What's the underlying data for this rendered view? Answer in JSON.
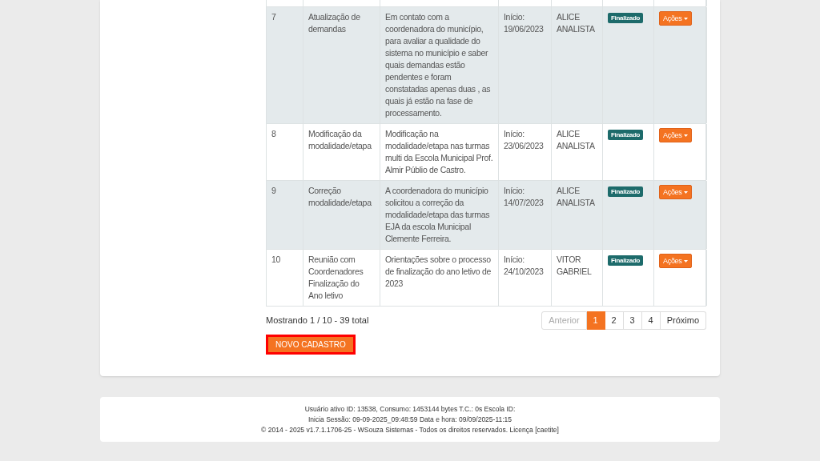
{
  "table": {
    "rows": [
      {
        "number": "7",
        "title": "Atualização de demandas",
        "description": "Em contato com a coordenadora do município, para avaliar a qualidade do sistema no município e saber quais demandas estão pendentes e foram constatadas apenas duas , as quais já estão na fase de processamento.",
        "date_label": "Início:",
        "date": "19/06/2023",
        "responsible": "ALICE ANALISTA",
        "status": "Finalizado",
        "actions": "Ações"
      },
      {
        "number": "8",
        "title": "Modificação da modalidade/etapa",
        "description": "Modificação na modalidade/etapa nas turmas multi da Escola Municipal Prof. Almir Públio de Castro.",
        "date_label": "Início:",
        "date": "23/06/2023",
        "responsible": "ALICE ANALISTA",
        "status": "Finalizado",
        "actions": "Ações"
      },
      {
        "number": "9",
        "title": "Correção modalidade/etapa",
        "description": "A coordenadora do município solicitou a correção da modalidade/etapa das turmas EJA da escola Municipal Clemente Ferreira.",
        "date_label": "Início:",
        "date": "14/07/2023",
        "responsible": "ALICE ANALISTA",
        "status": "Finalizado",
        "actions": "Ações"
      },
      {
        "number": "10",
        "title": "Reunião com Coordenadores Finalização do Ano letivo",
        "description": "Orientações sobre o processo de finalização do ano letivo de 2023",
        "date_label": "Início:",
        "date": "24/10/2023",
        "responsible": "VITOR GABRIEL",
        "status": "Finalizado",
        "actions": "Ações"
      }
    ]
  },
  "summary": "Mostrando 1 / 10 - 39 total",
  "pagination": {
    "previous": {
      "label": "Anterior",
      "disabled": true
    },
    "pages": [
      {
        "label": "1",
        "selected": true
      },
      {
        "label": "2",
        "selected": false
      },
      {
        "label": "3",
        "selected": false
      },
      {
        "label": "4",
        "selected": false
      }
    ],
    "next": {
      "label": "Próximo",
      "disabled": false
    }
  },
  "new_button": {
    "label": "NOVO CADASTRO",
    "highlighted": true
  },
  "footer": [
    "Usuário ativo ID: 13538, Consumo: 1453144 bytes T.C.: 0s Escola ID:",
    "Inicia Sessão: 09-09-2025_09:48:59 Data e hora: 09/09/2025-11:15",
    "© 2014 - 2025 v1.7.1.1706-25 - WSouza Sistemas - Todos os direitos reservados. Licença [caetite]"
  ]
}
